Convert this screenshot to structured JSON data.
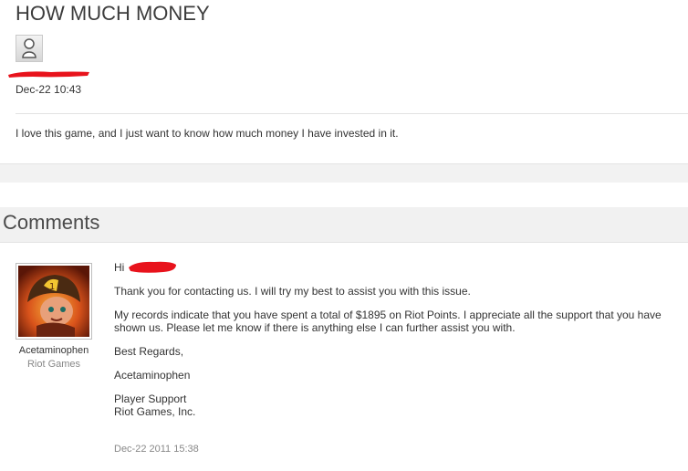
{
  "post": {
    "title": "HOW MUCH MONEY",
    "date": "Dec-22 10:43",
    "body": "I love this game, and I just want to know how much money I have invested in it."
  },
  "comments": {
    "header": "Comments",
    "items": [
      {
        "author": "Acetaminophen",
        "org": "Riot Games",
        "greeting": "Hi",
        "p1": "Thank you for contacting us. I will try my best to assist you with this issue.",
        "p2": "My records indicate that you have spent a total of $1895 on Riot Points. I appreciate all the support that you have shown us. Please let me know if there is anything else I can further assist you with.",
        "p3": "Best Regards,",
        "p4": "Acetaminophen",
        "sig1": "Player Support",
        "sig2": "Riot Games, Inc.",
        "date": "Dec-22 2011 15:38"
      }
    ]
  },
  "icons": {
    "user_avatar": "user-silhouette-icon",
    "agent_avatar": "champion-portrait-icon",
    "redaction": "red-scribble"
  },
  "colors": {
    "redaction": "#e8131c",
    "header_band": "#f1f1f1"
  }
}
